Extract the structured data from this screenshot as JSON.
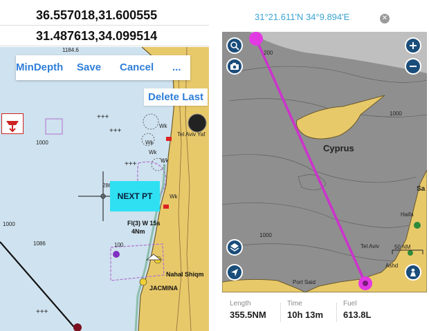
{
  "left_panel": {
    "coord_lines": [
      "36.557018,31.600555",
      "31.487613,34.099514"
    ],
    "toolbar": {
      "min_depth": "MinDepth",
      "save": "Save",
      "cancel": "Cancel",
      "more": "..."
    },
    "delete_last": "Delete Last",
    "next_pt": "NEXT PT",
    "map_labels": {
      "depth_1184": "1184.6",
      "depth_1000_a": "1000",
      "depth_1000_b": "1000",
      "depth_1086": "1086",
      "depth_286": "286",
      "depth_100": "100",
      "wk_1": "Wk",
      "wk_2": "Wk",
      "wk_3": "Wk",
      "wk_4": "Wk",
      "wk_5": "Wk",
      "tel_aviv": "Tel Aviv Yaf",
      "light_char": "Fl(3) W 15s",
      "light_range": "4Nm",
      "nahal": "Nahal Shiqm",
      "acmina": "JACMINA"
    }
  },
  "right_panel": {
    "header_coord": "31°21.611'N 34°9.894'E",
    "close_icon": "close-icon",
    "map_labels": {
      "cyprus": "Cyprus",
      "depth_1000_top": "1000",
      "depth_1000_mid": "1000",
      "depth_200": "200",
      "tel_aviv": "Tel Aviv",
      "haifa": "Haifa",
      "ashdod": "Ashd",
      "port_said": "Port Said",
      "sa": "Sa",
      "scale": "50 NM"
    },
    "buttons": [
      "search-icon",
      "camera-icon",
      "plus-icon",
      "minus-icon",
      "layers-icon",
      "navigate-icon",
      "person-icon"
    ],
    "stats": {
      "length_label": "Length",
      "length_value": "355.5NM",
      "time_label": "Time",
      "time_value": "10h 13m",
      "fuel_label": "Fuel",
      "fuel_value": "613.8L"
    }
  },
  "colors": {
    "route_line": "#cc33cc",
    "nav_button": "#1a4d7a",
    "link_blue": "#2f7ed8",
    "next_pt_bg": "#2fe0f2",
    "header_coord": "#3ba3d1",
    "land": "#e8c96a",
    "sea_left": "#cfe2ef",
    "sea_right": "#8f8f8f"
  }
}
